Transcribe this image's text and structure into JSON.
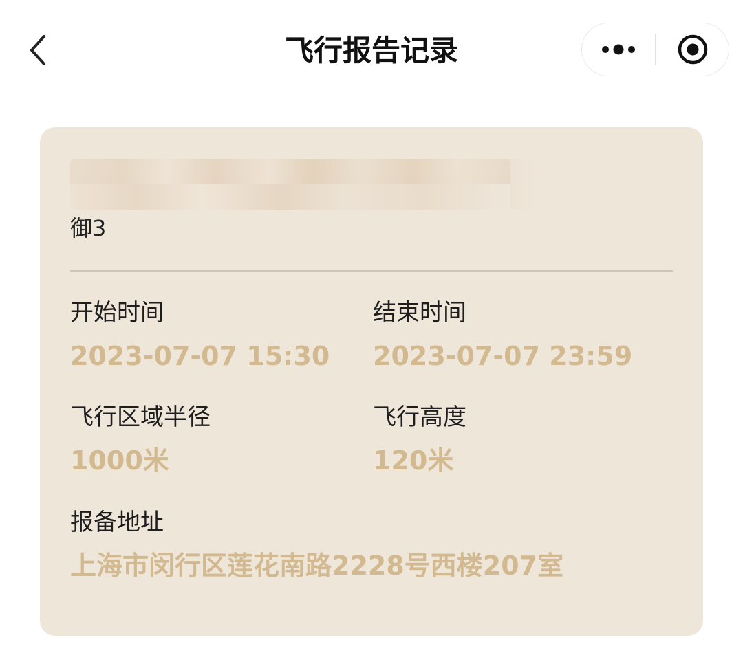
{
  "nav": {
    "title": "飞行报告记录",
    "back_icon": "chevron-left-icon",
    "more_icon": "more-dots-icon",
    "close_icon": "target-circle-icon"
  },
  "record": {
    "model": "御3",
    "start_label": "开始时间",
    "start_value": "2023-07-07 15:30",
    "end_label": "结束时间",
    "end_value": "2023-07-07 23:59",
    "radius_label": "飞行区域半径",
    "radius_value": "1000米",
    "altitude_label": "飞行高度",
    "altitude_value": "120米",
    "address_label": "报备地址",
    "address_value": "上海市闵行区莲花南路2228号西楼207室"
  },
  "colors": {
    "card_bg": "#efe6da",
    "value_gold": "#d2b990",
    "title_text": "#111111"
  }
}
